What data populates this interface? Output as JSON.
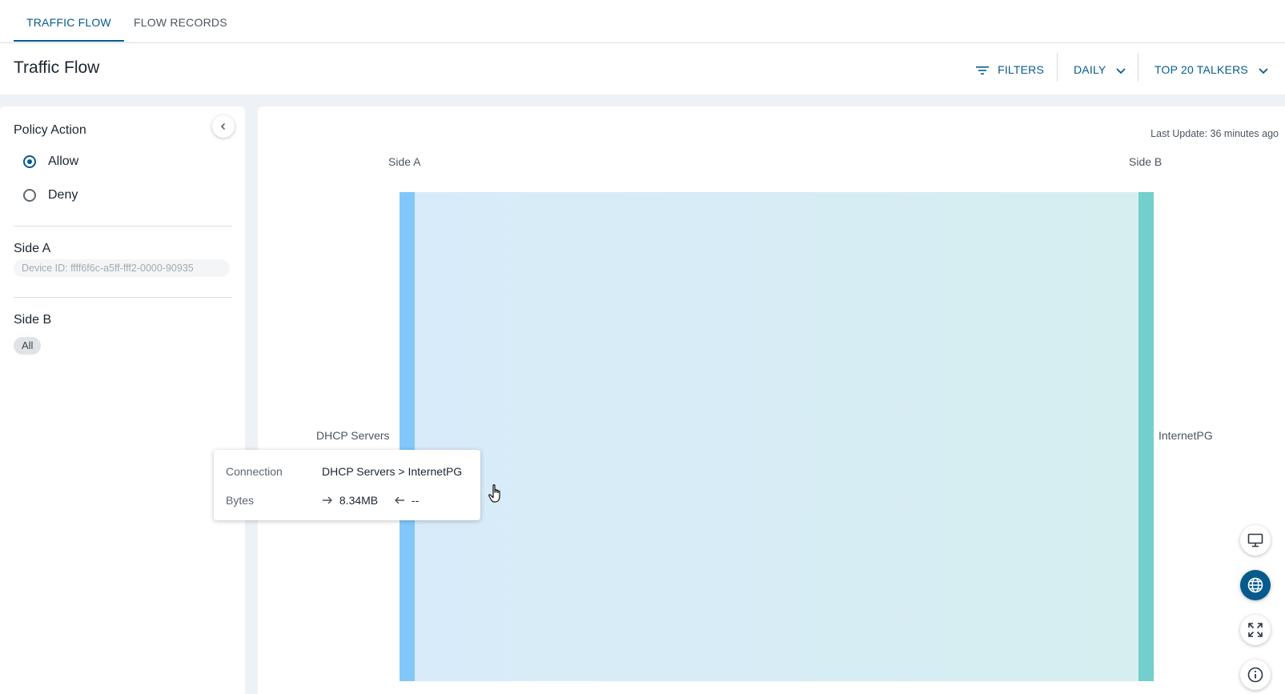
{
  "tabs": [
    {
      "label": "TRAFFIC FLOW",
      "active": true
    },
    {
      "label": "FLOW RECORDS",
      "active": false
    }
  ],
  "header": {
    "title": "Traffic Flow",
    "filters_label": "FILTERS",
    "period_label": "DAILY",
    "talkers_label": "TOP 20 TALKERS"
  },
  "sidebar": {
    "policy_action": {
      "title": "Policy Action",
      "options": [
        {
          "label": "Allow",
          "checked": true
        },
        {
          "label": "Deny",
          "checked": false
        }
      ]
    },
    "side_a": {
      "title": "Side A",
      "placeholder": "Device ID: ffff6f6c-a5ff-fff2-0000-90935"
    },
    "side_b": {
      "title": "Side B",
      "chip": "All"
    }
  },
  "chart": {
    "last_update": "Last Update: 36 minutes ago",
    "side_a_label": "Side A",
    "side_b_label": "Side B"
  },
  "chart_data": {
    "type": "sankey",
    "nodes": [
      {
        "name": "DHCP Servers",
        "side": "A",
        "color": "#82c7f9"
      },
      {
        "name": "InternetPG",
        "side": "B",
        "color": "#72cfcb"
      }
    ],
    "links": [
      {
        "source": "DHCP Servers",
        "target": "InternetPG",
        "bytes_forward": "8.34MB",
        "bytes_reverse": "--"
      }
    ]
  },
  "tooltip": {
    "connection_key": "Connection",
    "connection_value": "DHCP Servers > InternetPG",
    "bytes_key": "Bytes",
    "bytes_forward": "8.34MB",
    "bytes_reverse": "--"
  },
  "fabs": [
    {
      "icon": "monitor-icon",
      "active": false
    },
    {
      "icon": "globe-icon",
      "active": true
    },
    {
      "icon": "expand-icon",
      "active": false
    },
    {
      "icon": "info-icon",
      "active": false
    }
  ],
  "colors": {
    "accent": "#075a8c",
    "link_start": "#d8ebfa",
    "link_end": "#d6eef0"
  }
}
